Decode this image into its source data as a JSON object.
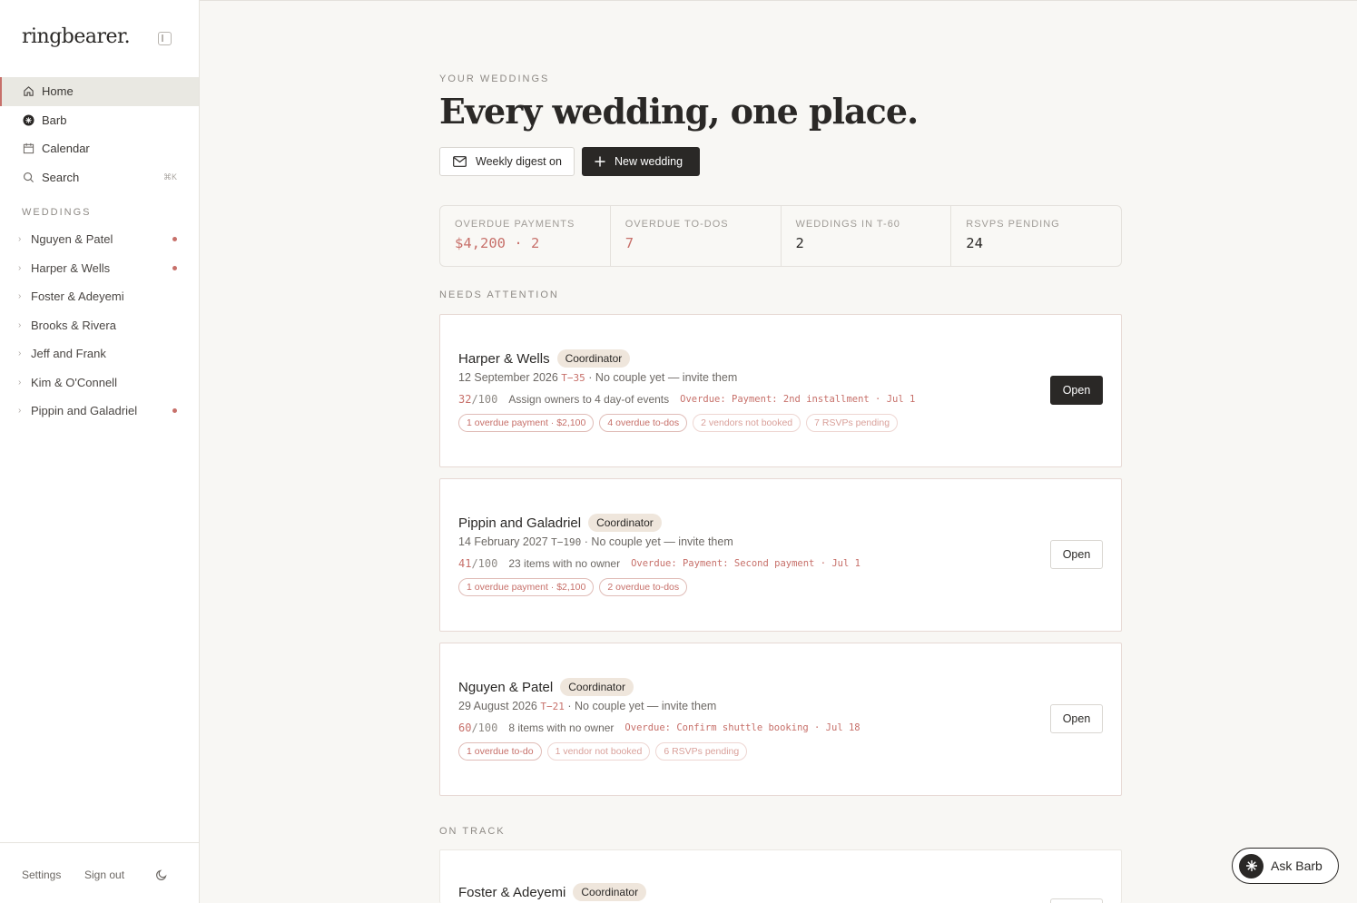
{
  "brand": "ringbearer.",
  "nav": [
    {
      "label": "Home",
      "icon": "home-icon"
    },
    {
      "label": "Barb",
      "icon": "barb-icon"
    },
    {
      "label": "Calendar",
      "icon": "calendar-icon"
    },
    {
      "label": "Search",
      "icon": "search-icon",
      "shortcut": "⌘K"
    }
  ],
  "sidebar_section": "WEDDINGS",
  "weddings": [
    {
      "label": "Nguyen & Patel",
      "alert": true
    },
    {
      "label": "Harper & Wells",
      "alert": true
    },
    {
      "label": "Foster & Adeyemi",
      "alert": false
    },
    {
      "label": "Brooks & Rivera",
      "alert": false
    },
    {
      "label": "Jeff and Frank",
      "alert": false
    },
    {
      "label": "Kim & O'Connell",
      "alert": false
    },
    {
      "label": "Pippin and Galadriel",
      "alert": true
    }
  ],
  "footer": {
    "settings": "Settings",
    "signout": "Sign out"
  },
  "header": {
    "eyebrow": "YOUR WEDDINGS",
    "title": "Every wedding, one place.",
    "digest_label": "Weekly digest on",
    "new_label": "New wedding"
  },
  "stats": [
    {
      "label": "OVERDUE PAYMENTS",
      "value": "$4,200 · 2"
    },
    {
      "label": "OVERDUE TO-DOS",
      "value": "7"
    },
    {
      "label": "WEDDINGS IN T-60",
      "value": "2"
    },
    {
      "label": "RSVPS PENDING",
      "value": "24"
    }
  ],
  "sections": {
    "attention": "NEEDS ATTENTION",
    "on_track": "ON TRACK"
  },
  "cards": [
    {
      "name": "Harper & Wells",
      "role": "Coordinator",
      "date": "12 September 2026",
      "countdown": "T−35",
      "couple": "· No couple yet — invite them",
      "score": "32",
      "score_den": "/100",
      "task": "Assign owners to 4 day-of events",
      "overdue": "Overdue: Payment: 2nd installment · Jul 1",
      "chips": [
        {
          "text": "1 overdue payment · $2,100",
          "soft": false
        },
        {
          "text": "4 overdue to-dos",
          "soft": false
        },
        {
          "text": "2 vendors not booked",
          "soft": true
        },
        {
          "text": "7 RSVPs pending",
          "soft": true
        }
      ],
      "open": "Open"
    },
    {
      "name": "Pippin and Galadriel",
      "role": "Coordinator",
      "date": "14 February 2027",
      "countdown": "T−190",
      "couple": "· No couple yet — invite them",
      "score": "41",
      "score_den": "/100",
      "task": "23 items with no owner",
      "overdue": "Overdue: Payment: Second payment · Jul 1",
      "chips": [
        {
          "text": "1 overdue payment · $2,100",
          "soft": false
        },
        {
          "text": "2 overdue to-dos",
          "soft": false
        }
      ],
      "open": "Open"
    },
    {
      "name": "Nguyen & Patel",
      "role": "Coordinator",
      "date": "29 August 2026",
      "countdown": "T−21",
      "couple": "· No couple yet — invite them",
      "score": "60",
      "score_den": "/100",
      "task": "8 items with no owner",
      "overdue": "Overdue: Confirm shuttle booking · Jul 18",
      "chips": [
        {
          "text": "1 overdue to-do",
          "soft": false
        },
        {
          "text": "1 vendor not booked",
          "soft": true
        },
        {
          "text": "6 RSVPs pending",
          "soft": true
        }
      ],
      "open": "Open"
    }
  ],
  "on_track_card": {
    "name": "Foster & Adeyemi",
    "role": "Coordinator"
  },
  "ask_barb": "Ask Barb"
}
